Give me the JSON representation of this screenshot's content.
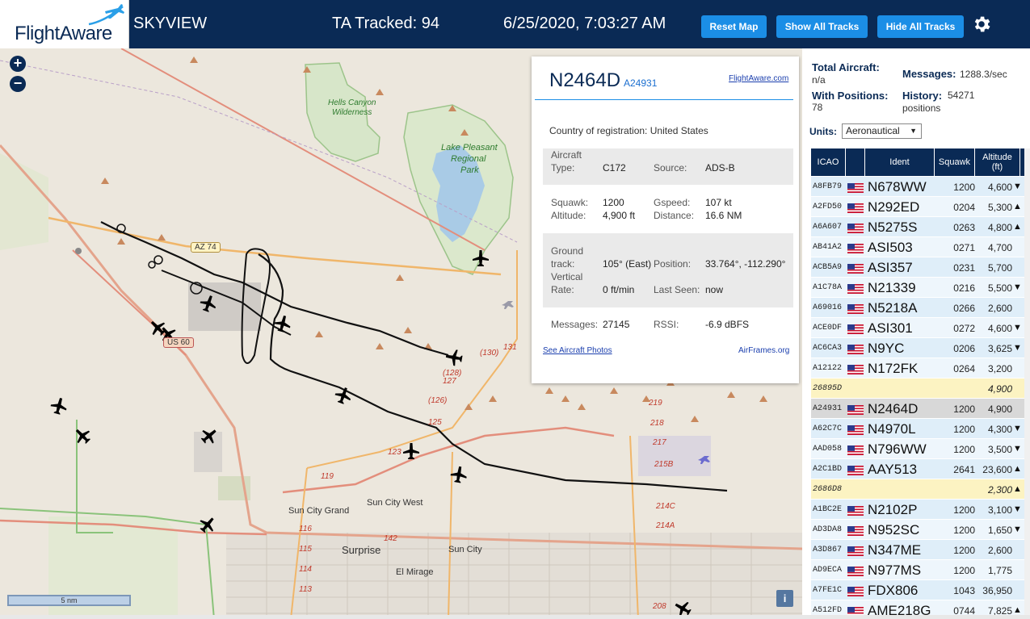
{
  "header": {
    "logo": "FlightAware",
    "app_title": "SKYVIEW",
    "tracked": "TA Tracked: 94",
    "datetime": "6/25/2020, 7:03:27 AM",
    "buttons": {
      "reset": "Reset Map",
      "show_all": "Show All Tracks",
      "hide_all": "Hide All Tracks"
    },
    "icons": {
      "logo": "plane-logo-icon",
      "settings": "gear-icon"
    },
    "colors": {
      "bar": "#0a2a55",
      "button": "#1b8ee6"
    }
  },
  "map": {
    "zoom_in": "+",
    "zoom_out": "−",
    "scale": "5 nm",
    "info": "i",
    "labels": {
      "hells_canyon": "Hells Canyon",
      "wilderness": "Wilderness",
      "lake_pleasant_1": "Lake Pleasant",
      "lake_pleasant_2": "Regional",
      "lake_pleasant_3": "Park",
      "az74": "AZ 74",
      "us60": "US 60",
      "sun_city_grand": "Sun City Grand",
      "sun_city_west": "Sun City West",
      "surprise": "Surprise",
      "sun_city": "Sun City",
      "el_mirage": "El Mirage",
      "r130": "(130)",
      "r128": "(128)",
      "r127": "127",
      "r126": "(126)",
      "r131": "131",
      "r125": "125",
      "r123": "123",
      "r119": "119",
      "r142": "142",
      "r116": "116",
      "r115": "115",
      "r114": "114",
      "r113": "113",
      "r219": "219",
      "r218": "218",
      "r217": "217",
      "r215b": "215B",
      "r214c": "214C",
      "r214a": "214A",
      "r208": "208"
    }
  },
  "popup": {
    "registration": "N2464D",
    "hex": "A24931",
    "fa_link": "FlightAware.com",
    "country_label": "Country of registration:",
    "country": "United States",
    "fields": {
      "aircraft_type_l1": "Aircraft",
      "aircraft_type_l2": "Type:",
      "aircraft_type": "C172",
      "source_l": "Source:",
      "source": "ADS-B",
      "squawk_l": "Squawk:",
      "squawk": "1200",
      "gspeed_l": "Gspeed:",
      "gspeed": "107 kt",
      "altitude_l": "Altitude:",
      "altitude": "4,900 ft",
      "distance_l": "Distance:",
      "distance": "16.6 NM",
      "ground_l1": "Ground",
      "ground_l2": "track:",
      "ground": "105° (East)",
      "position_l": "Position:",
      "position": "33.764°, -112.290°",
      "vrate_l1": "Vertical",
      "vrate_l2": "Rate:",
      "vrate": "0 ft/min",
      "lastseen_l": "Last Seen:",
      "lastseen": "now",
      "messages_l": "Messages:",
      "messages": "27145",
      "rssi_l": "RSSI:",
      "rssi": "-6.9 dBFS"
    },
    "photos": "See Aircraft Photos",
    "airframes": "AirFrames.org"
  },
  "side": {
    "total_label": "Total Aircraft:",
    "total": "n/a",
    "messages_label": "Messages:",
    "messages": "1288.3/sec",
    "positions_label": "With Positions:",
    "positions": "78",
    "history_label": "History:",
    "history": "54271",
    "history_unit": "positions",
    "units_label": "Units:",
    "units_value": "Aeronautical",
    "columns": {
      "icao": "ICAO",
      "ident": "Ident",
      "squawk": "Squawk",
      "alt1": "Altitude",
      "alt2": "(ft)"
    },
    "rows": [
      {
        "icao": "A8FB79",
        "ident": "N678WW",
        "squawk": "1200",
        "alt": "4,600",
        "trend": "▼",
        "type": "normal"
      },
      {
        "icao": "A2FD50",
        "ident": "N292ED",
        "squawk": "0204",
        "alt": "5,300",
        "trend": "▲",
        "type": "normal"
      },
      {
        "icao": "A6A607",
        "ident": "N5275S",
        "squawk": "0263",
        "alt": "4,800",
        "trend": "▲",
        "type": "normal"
      },
      {
        "icao": "AB41A2",
        "ident": "ASI503",
        "squawk": "0271",
        "alt": "4,700",
        "trend": "",
        "type": "normal"
      },
      {
        "icao": "ACB5A9",
        "ident": "ASI357",
        "squawk": "0231",
        "alt": "5,700",
        "trend": "",
        "type": "normal"
      },
      {
        "icao": "A1C78A",
        "ident": "N21339",
        "squawk": "0216",
        "alt": "5,500",
        "trend": "▼",
        "type": "normal"
      },
      {
        "icao": "A69016",
        "ident": "N5218A",
        "squawk": "0266",
        "alt": "2,600",
        "trend": "",
        "type": "normal"
      },
      {
        "icao": "ACE0DF",
        "ident": "ASI301",
        "squawk": "0272",
        "alt": "4,600",
        "trend": "▼",
        "type": "normal"
      },
      {
        "icao": "AC6CA3",
        "ident": "N9YC",
        "squawk": "0206",
        "alt": "3,625",
        "trend": "▼",
        "type": "normal"
      },
      {
        "icao": "A12122",
        "ident": "N172FK",
        "squawk": "0264",
        "alt": "3,200",
        "trend": "",
        "type": "normal"
      },
      {
        "icao": "26895D",
        "ident": "",
        "squawk": "",
        "alt": "4,900",
        "trend": "",
        "type": "nopos"
      },
      {
        "icao": "A24931",
        "ident": "N2464D",
        "squawk": "1200",
        "alt": "4,900",
        "trend": "",
        "type": "sel"
      },
      {
        "icao": "A62C7C",
        "ident": "N4970L",
        "squawk": "1200",
        "alt": "4,300",
        "trend": "▼",
        "type": "normal"
      },
      {
        "icao": "AAD058",
        "ident": "N796WW",
        "squawk": "1200",
        "alt": "3,500",
        "trend": "▼",
        "type": "normal"
      },
      {
        "icao": "A2C1BD",
        "ident": "AAY513",
        "squawk": "2641",
        "alt": "23,600",
        "trend": "▲",
        "type": "normal"
      },
      {
        "icao": "2686D8",
        "ident": "",
        "squawk": "",
        "alt": "2,300",
        "trend": "▲",
        "type": "nopos"
      },
      {
        "icao": "A1BC2E",
        "ident": "N2102P",
        "squawk": "1200",
        "alt": "3,100",
        "trend": "▼",
        "type": "normal"
      },
      {
        "icao": "AD3DA8",
        "ident": "N952SC",
        "squawk": "1200",
        "alt": "1,650",
        "trend": "▼",
        "type": "normal"
      },
      {
        "icao": "A3D867",
        "ident": "N347ME",
        "squawk": "1200",
        "alt": "2,600",
        "trend": "",
        "type": "normal"
      },
      {
        "icao": "AD9ECA",
        "ident": "N977MS",
        "squawk": "1200",
        "alt": "1,775",
        "trend": "",
        "type": "normal"
      },
      {
        "icao": "A7FE1C",
        "ident": "FDX806",
        "squawk": "1043",
        "alt": "36,950",
        "trend": "",
        "type": "normal"
      },
      {
        "icao": "A512FD",
        "ident": "AME218G",
        "squawk": "0744",
        "alt": "7,825",
        "trend": "▲",
        "type": "normal"
      }
    ]
  }
}
